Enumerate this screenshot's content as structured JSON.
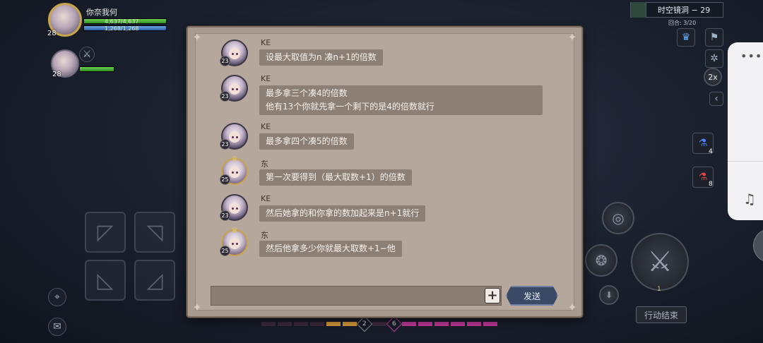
{
  "hud": {
    "player_name": "你奈我何",
    "player_level": "28",
    "player_hp": "4,637/4,637",
    "player_mp": "1,268/1,268",
    "ally_level": "28",
    "stage": "时空镜洞 − 29",
    "round": "回合: 3/20",
    "speed": "2x",
    "potion1_count": "4",
    "potion2_count": "8",
    "skill_level": "1",
    "end_turn": "行动结束",
    "energy_left": "2",
    "energy_right": "6"
  },
  "chat": {
    "messages": [
      {
        "sender": "KE",
        "level": "23",
        "lines": [
          "设最大取值为n 凑n+1的倍数"
        ],
        "gold": false
      },
      {
        "sender": "KE",
        "level": "23",
        "lines": [
          "最多拿三个凑4的倍数",
          "他有13个你就先拿一个剩下的是4的倍数就行"
        ],
        "gold": false
      },
      {
        "sender": "KE",
        "level": "23",
        "lines": [
          "最多拿四个凑5的倍数"
        ],
        "gold": false
      },
      {
        "sender": "东枝",
        "level": "25",
        "lines": [
          "第一次要得到（最大取数+1）的倍数"
        ],
        "gold": true
      },
      {
        "sender": "KE",
        "level": "23",
        "lines": [
          "然后她拿的和你拿的数加起来是n+1就行"
        ],
        "gold": false
      },
      {
        "sender": "东枝",
        "level": "25",
        "lines": [
          "然后他拿多少你就最大取数+1−他"
        ],
        "gold": true
      }
    ],
    "input_placeholder": "",
    "plus_label": "+",
    "send_label": "发送"
  },
  "float_panel": {
    "menu_icon": "more-dots-icon",
    "music_icon": "music-note-icon"
  }
}
